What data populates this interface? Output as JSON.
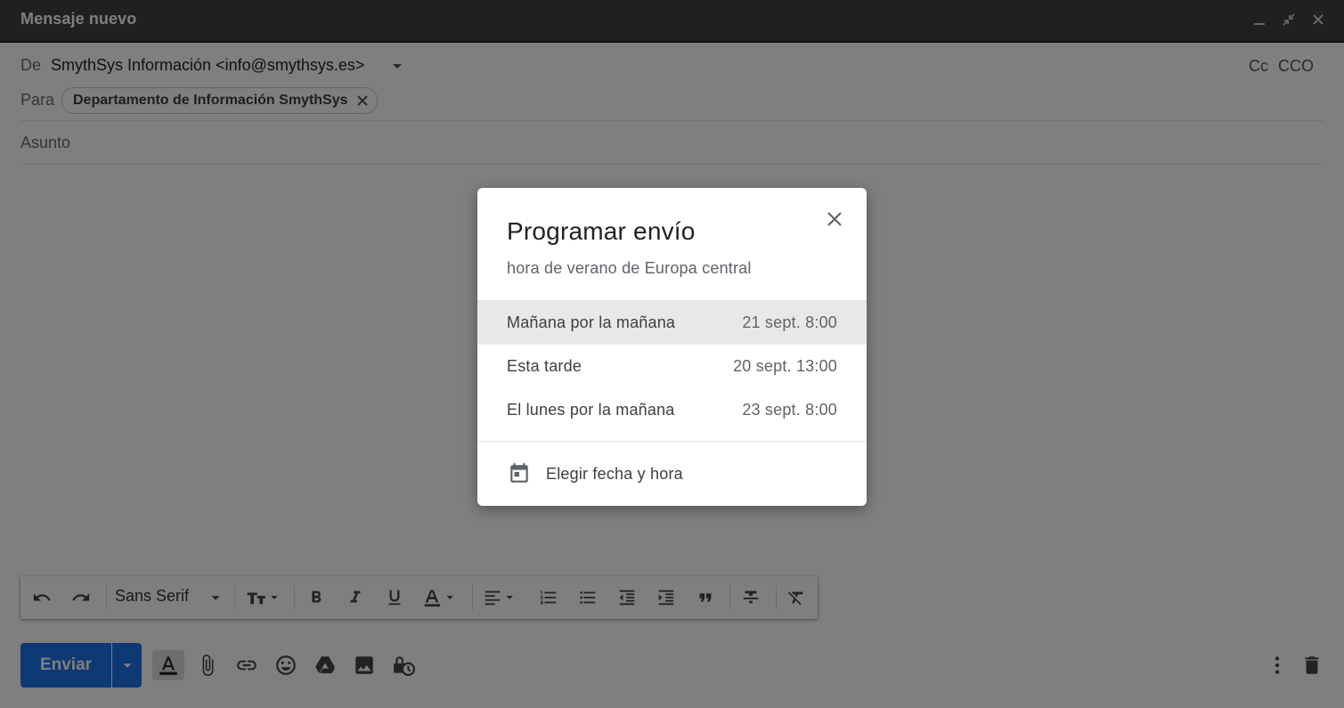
{
  "window": {
    "title": "Mensaje nuevo"
  },
  "compose": {
    "from_label": "De",
    "from_value": "SmythSys Información <info@smythsys.es>",
    "cc_label": "Cc",
    "bcc_label": "CCO",
    "to_label": "Para",
    "recipient": "Departamento de Información SmythSys",
    "subject_placeholder": "Asunto"
  },
  "toolbar": {
    "font_name": "Sans Serif"
  },
  "actions": {
    "send_label": "Enviar"
  },
  "dialog": {
    "title": "Programar envío",
    "subtitle": "hora de verano de Europa central",
    "options": [
      {
        "label": "Mañana por la mañana",
        "when": "21 sept. 8:00",
        "selected": true
      },
      {
        "label": "Esta tarde",
        "when": "20 sept. 13:00",
        "selected": false
      },
      {
        "label": "El lunes por la mañana",
        "when": "23 sept. 8:00",
        "selected": false
      }
    ],
    "pick_label": "Elegir fecha y hora"
  },
  "colors": {
    "accent": "#1a73e8",
    "titlebar": "#404040"
  },
  "icons": {
    "window": [
      "minimize-icon",
      "exit-fullscreen-icon",
      "close-icon"
    ],
    "toolbar": [
      "undo-icon",
      "redo-icon",
      "text-size-icon",
      "bold-icon",
      "italic-icon",
      "underline-icon",
      "text-color-icon",
      "align-icon",
      "numbered-list-icon",
      "bulleted-list-icon",
      "indent-less-icon",
      "indent-more-icon",
      "quote-icon",
      "strikethrough-icon",
      "remove-formatting-icon"
    ],
    "bottom": [
      "formatting-options-icon",
      "attach-icon",
      "link-icon",
      "emoji-icon",
      "drive-icon",
      "photo-icon",
      "confidential-mode-icon",
      "more-options-icon",
      "trash-icon"
    ]
  }
}
